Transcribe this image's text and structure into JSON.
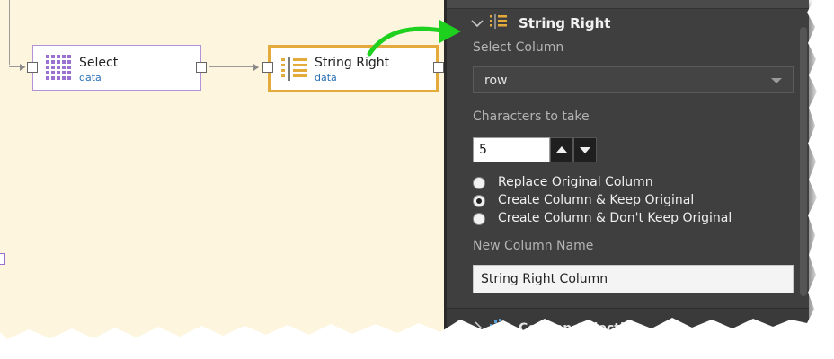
{
  "canvas": {
    "nodes": [
      {
        "title": "Select",
        "subtitle": "data"
      },
      {
        "title": "String Right",
        "subtitle": "data"
      }
    ]
  },
  "panel": {
    "title": "String Right",
    "select_column": {
      "label": "Select Column",
      "value": "row"
    },
    "characters": {
      "label": "Characters to take",
      "value": "5"
    },
    "output_options": [
      {
        "label": "Replace Original Column",
        "checked": false
      },
      {
        "label": "Create Column & Keep Original",
        "checked": true
      },
      {
        "label": "Create Column & Don't Keep Original",
        "checked": false
      }
    ],
    "new_column": {
      "label": "New Column Name",
      "value": "String Right Column"
    },
    "next_section": {
      "title": "Column Selection"
    }
  },
  "colors": {
    "canvas_bg": "#fdf5dd",
    "panel_bg": "#3f3f3f",
    "accent_orange": "#e3aa3c",
    "select_node_border": "#b392d9",
    "callout_arrow": "#1fd11f"
  },
  "icons": {
    "select_node": "grid-icon",
    "string_node": "string-list-icon",
    "callout": "green-arrow-annotation"
  }
}
